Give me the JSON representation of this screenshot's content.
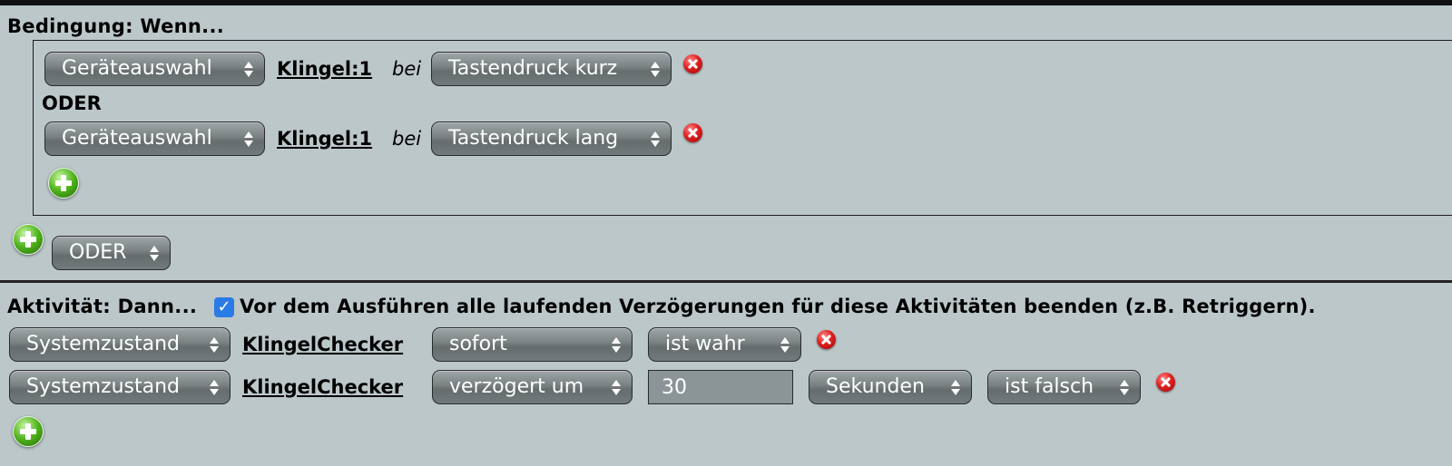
{
  "condition": {
    "heading": "Bedingung: Wenn...",
    "rows": [
      {
        "type_select": "Geräteauswahl",
        "device": "Klingel:1",
        "connector": "bei",
        "event_select": "Tastendruck kurz",
        "remove_icon": "remove-icon"
      },
      {
        "type_select": "Geräteauswahl",
        "device": "Klingel:1",
        "connector": "bei",
        "event_select": "Tastendruck lang",
        "remove_icon": "remove-icon"
      }
    ],
    "or_label": "ODER",
    "add_icon": "add-icon",
    "outer_add_icon": "add-icon",
    "logic_select": "ODER"
  },
  "activity": {
    "heading": "Aktivität: Dann...",
    "retrigger_checked": true,
    "retrigger_label": "Vor dem Ausführen alle laufenden Verzögerungen für diese Aktivitäten beenden (z.B. Retriggern).",
    "rows": [
      {
        "type_select": "Systemzustand",
        "target": "KlingelChecker",
        "timing_select": "sofort",
        "value_select": "ist wahr"
      },
      {
        "type_select": "Systemzustand",
        "target": "KlingelChecker",
        "timing_select": "verzögert um",
        "delay_value": "30",
        "unit_select": "Sekunden",
        "value_select": "ist falsch"
      }
    ],
    "add_icon": "add-icon"
  },
  "colors": {
    "background": "#bcc7ca",
    "select": "#7b8385",
    "remove": "#e02020",
    "add": "#4fb31c",
    "checkbox": "#2a7be6"
  }
}
